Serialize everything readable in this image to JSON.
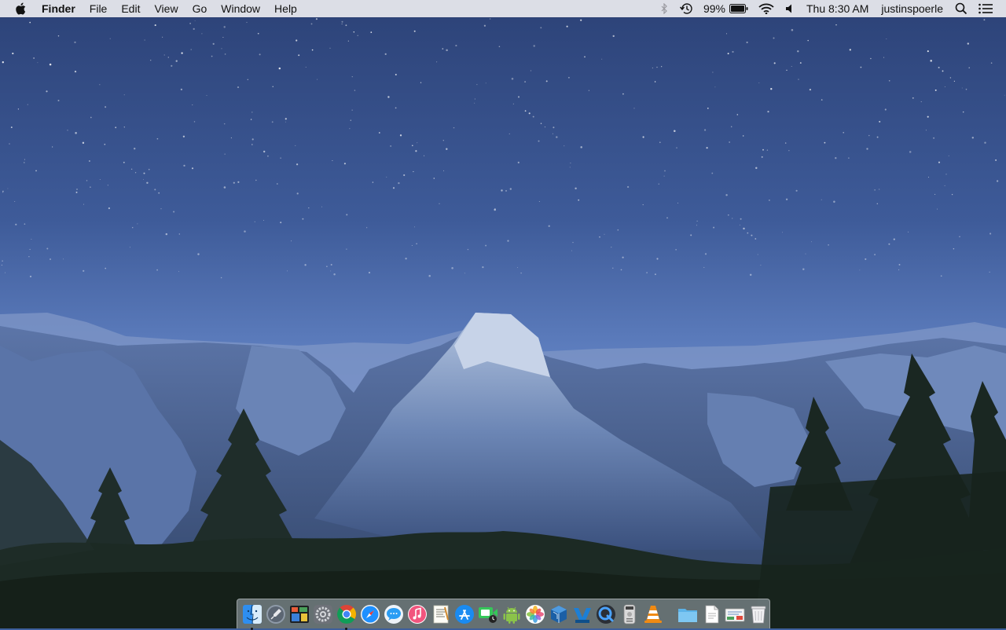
{
  "menubar": {
    "app_name": "Finder",
    "menus": [
      "File",
      "Edit",
      "View",
      "Go",
      "Window",
      "Help"
    ],
    "status": {
      "battery_percent": "99%",
      "clock": "Thu 8:30 AM",
      "username": "justinspoerle"
    }
  },
  "dock": {
    "apps": [
      {
        "name": "finder-icon",
        "running": true
      },
      {
        "name": "launchpad-icon",
        "running": false
      },
      {
        "name": "mission-control-icon",
        "running": false
      },
      {
        "name": "system-preferences-icon",
        "running": false
      },
      {
        "name": "chrome-icon",
        "running": true
      },
      {
        "name": "safari-icon",
        "running": false
      },
      {
        "name": "messages-icon",
        "running": false
      },
      {
        "name": "itunes-icon",
        "running": false
      },
      {
        "name": "textedit-icon",
        "running": false
      },
      {
        "name": "app-store-icon",
        "running": false
      },
      {
        "name": "facetime-icon",
        "running": false
      },
      {
        "name": "android-icon",
        "running": false
      },
      {
        "name": "photos-icon",
        "running": false
      },
      {
        "name": "virtualbox-icon",
        "running": false
      },
      {
        "name": "vmware-icon",
        "running": false
      },
      {
        "name": "quicktime-icon",
        "running": false
      },
      {
        "name": "dvd-player-icon",
        "running": false
      },
      {
        "name": "vlc-icon",
        "running": false
      }
    ],
    "stacks": [
      {
        "name": "applications-folder-icon"
      },
      {
        "name": "document-stack-icon"
      },
      {
        "name": "downloads-stack-icon"
      },
      {
        "name": "trash-icon"
      }
    ]
  },
  "colors": {
    "sky_top": "#2c4277",
    "sky_horizon": "#6f8fd0",
    "mountain": "#6c86b5",
    "forest": "#1c2a24"
  }
}
